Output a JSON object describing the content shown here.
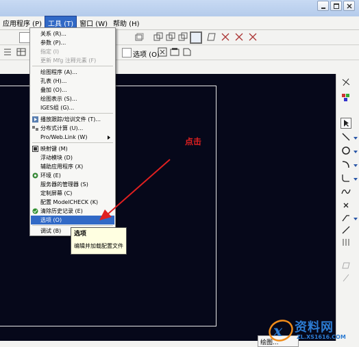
{
  "menubar": {
    "items": [
      "应用程序 (P)",
      "工具 (T)",
      "窗口 (W)",
      "帮助 (H)"
    ],
    "active_index": 1
  },
  "toolbar2": {
    "options_label": "选项 (O)"
  },
  "tools_menu": {
    "items": [
      {
        "label": "关系 (R)...",
        "disabled": false
      },
      {
        "label": "参数 (P)...",
        "disabled": false
      },
      {
        "label": "指定 (I)",
        "disabled": true
      },
      {
        "label": "更新 Mfg 注释元素 (F)",
        "disabled": true
      },
      {
        "label": "绘图程序 (A)...",
        "disabled": false
      },
      {
        "label": "孔表 (H)...",
        "disabled": false
      },
      {
        "label": "叠加 (O)...",
        "disabled": false
      },
      {
        "label": "绘图表示 (S)...",
        "disabled": false
      },
      {
        "label": "IGES组 (G)...",
        "disabled": false
      },
      {
        "label": "播放跟踪/培训文件 (T)...",
        "disabled": false,
        "icon": "playback-icon"
      },
      {
        "label": "分布式计算 (U)...",
        "disabled": false,
        "icon": "distributed-icon"
      },
      {
        "label": "Pro/Web.Link (W)",
        "disabled": false,
        "submenu": true
      },
      {
        "label": "映射键 (M)",
        "disabled": false,
        "icon": "mapkey-icon"
      },
      {
        "label": "浮动模块 (D)",
        "disabled": false
      },
      {
        "label": "辅助应用程序 (X)",
        "disabled": false
      },
      {
        "label": "环境 (E)",
        "disabled": false,
        "icon": "environment-icon"
      },
      {
        "label": "服务器的管理器 (S)",
        "disabled": false
      },
      {
        "label": "定制屏幕 (C)",
        "disabled": false
      },
      {
        "label": "配置 ModelCHECK (K)",
        "disabled": false
      },
      {
        "label": "清除历史记录 (E)",
        "disabled": false,
        "icon": "clear-history-icon"
      },
      {
        "label": "选项 (O)",
        "disabled": false,
        "highlighted": true
      },
      {
        "label": "调试 (B)",
        "disabled": false
      }
    ]
  },
  "tooltip": {
    "title": "选项",
    "description": "编辑并加载配置文件"
  },
  "annotation": {
    "text": "点击",
    "color": "#e02020"
  },
  "status": {
    "text": "绘图..."
  },
  "watermark": {
    "main": "资料网",
    "sub": "ZL.XS1616.COM"
  },
  "colors": {
    "accent": "#3169c6",
    "canvas": "#06081a",
    "watermark": "#2c7bd2"
  }
}
